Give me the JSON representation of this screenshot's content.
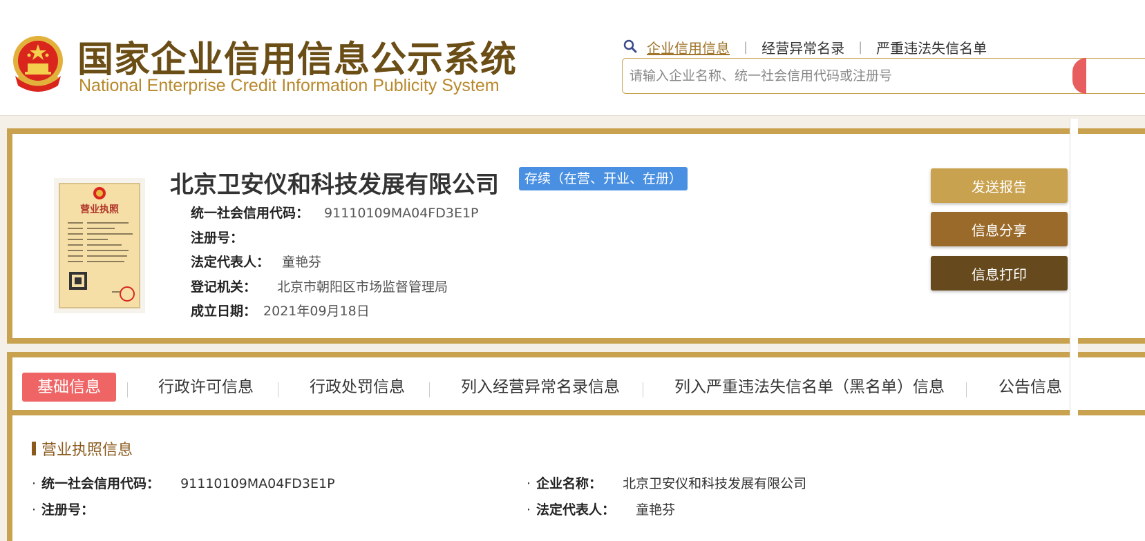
{
  "header": {
    "title_cn": "国家企业信用信息公示系统",
    "title_en": "National Enterprise Credit Information Publicity System",
    "nav": [
      {
        "label": "企业信用信息"
      },
      {
        "label": "经营异常名录"
      },
      {
        "label": "严重违法失信名单"
      }
    ],
    "search_placeholder": "请输入企业名称、统一社会信用代码或注册号"
  },
  "company": {
    "name": "北京卫安仪和科技发展有限公司",
    "status": "存续（在营、开业、在册）",
    "fields": [
      {
        "label": "统一社会信用代码：",
        "value": "91110109MA04FD3E1P"
      },
      {
        "label": "注册号：",
        "value": ""
      },
      {
        "label": "法定代表人：",
        "value": "童艳芬"
      },
      {
        "label": "登记机关：",
        "value": "北京市朝阳区市场监督管理局"
      },
      {
        "label": "成立日期：",
        "value": "2021年09月18日"
      }
    ],
    "license_title": "营业执照"
  },
  "actions": {
    "send": "发送报告",
    "share": "信息分享",
    "print": "信息打印"
  },
  "tabs": [
    {
      "label": "基础信息"
    },
    {
      "label": "行政许可信息"
    },
    {
      "label": "行政处罚信息"
    },
    {
      "label": "列入经营异常名录信息"
    },
    {
      "label": "列入严重违法失信名单（黑名单）信息"
    },
    {
      "label": "公告信息"
    }
  ],
  "detail": {
    "section_title": "营业执照信息",
    "rows": [
      {
        "label": "统一社会信用代码：",
        "value": "91110109MA04FD3E1P"
      },
      {
        "label": "企业名称：",
        "value": "北京卫安仪和科技发展有限公司"
      },
      {
        "label": "注册号：",
        "value": ""
      },
      {
        "label": "法定代表人：",
        "value": "童艳芬"
      }
    ]
  },
  "colors": {
    "gold": "#c9a24f",
    "brown": "#6b4e16",
    "active_tab": "#ef6464",
    "status_blue": "#4a90e2"
  }
}
